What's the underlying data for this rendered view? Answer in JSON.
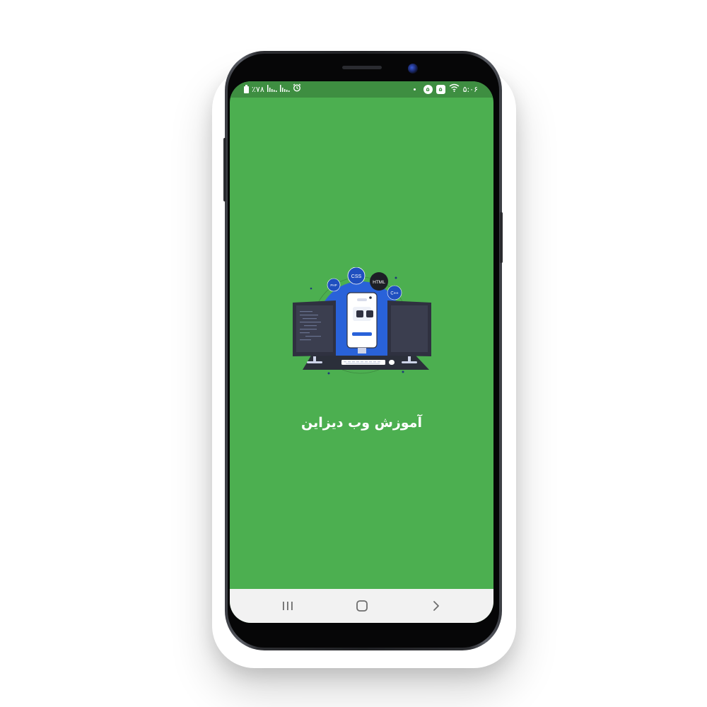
{
  "status_bar": {
    "battery": "٪۷۸",
    "time": "۵:۰۶",
    "badge_1": "۵",
    "badge_2": "۵"
  },
  "splash": {
    "title": "آموزش وب دیزاین",
    "illustration": {
      "bubble_labels": [
        "CSS",
        "HTML",
        "PHP",
        "C++"
      ]
    },
    "background_color": "#4caf50"
  },
  "navigation_bar": {
    "recents_icon": "recents-icon",
    "home_icon": "home-icon",
    "back_icon": "back-icon"
  }
}
